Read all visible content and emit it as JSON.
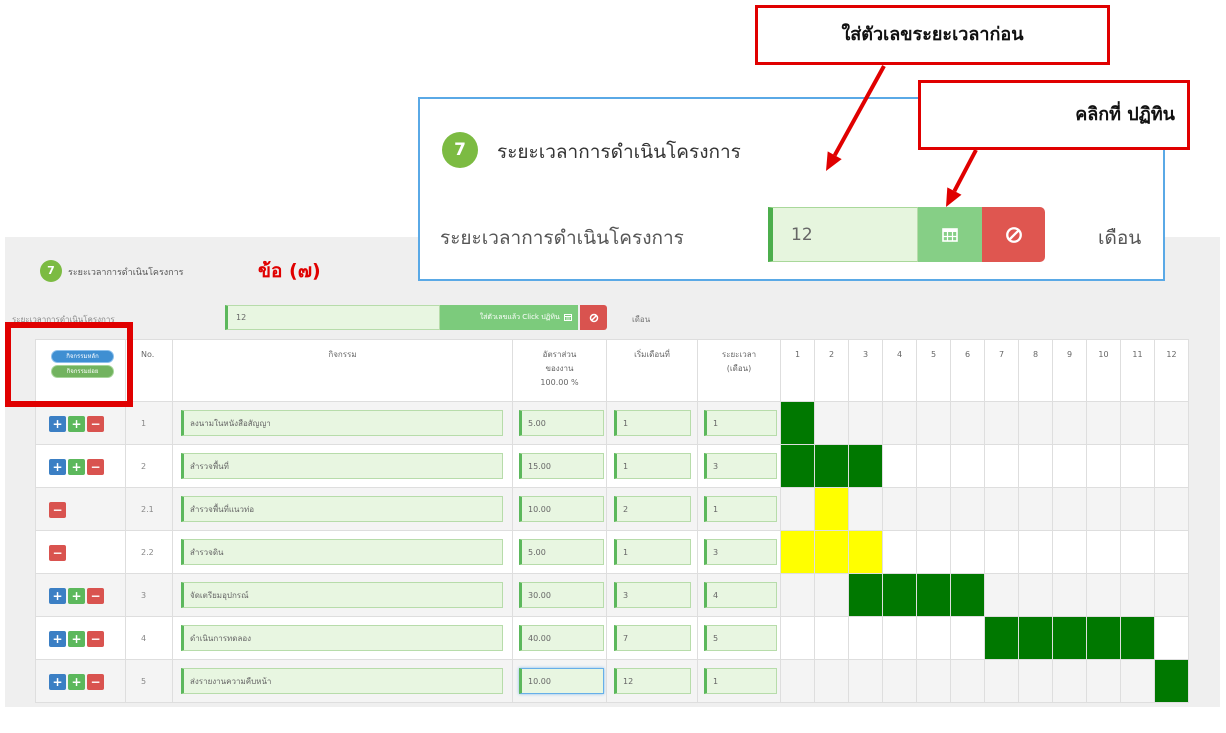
{
  "callouts": {
    "enter_number": "ใส่ตัวเลขระยะเวลาก่อน",
    "click_calendar": "คลิกที่ ปฏิทิน"
  },
  "zoom_panel": {
    "step_number": "7",
    "title": "ระยะเวลาการดำเนินโครงการ",
    "field_label": "ระยะเวลาการดำเนินโครงการ",
    "duration_value": "12",
    "unit": "เดือน",
    "calendar_icon": "calendar-icon",
    "cancel_icon": "ban-icon"
  },
  "section": {
    "step_number": "7",
    "title": "ระยะเวลาการดำเนินโครงการ",
    "annotation": "ข้อ (๗)",
    "field_label": "ระยะเวลาการดำเนินโครงการ",
    "duration_value": "12",
    "calendar_button_label": "ใส่ตัวเลขแล้ว Click ปฏิทิน",
    "unit": "เดือน"
  },
  "table": {
    "toggle_buttons": {
      "main": "กิจกรรมหลัก",
      "sub": "กิจกรรมย่อย"
    },
    "headers": {
      "no": "No.",
      "activity": "กิจกรรม",
      "weight": [
        "อัตราส่วน",
        "ของงาน",
        "100.00 %"
      ],
      "start": "เริ่มเดือนที่",
      "duration": [
        "ระยะเวลา",
        "(เดือน)"
      ]
    },
    "row_actions": {
      "add_main": "+",
      "add_sub": "+",
      "delete": "−"
    },
    "months": [
      "1",
      "2",
      "3",
      "4",
      "5",
      "6",
      "7",
      "8",
      "9",
      "10",
      "11",
      "12"
    ],
    "rows": [
      {
        "no": "1",
        "type": "main",
        "activity": "ลงนามในหนังสือสัญญา",
        "weight": "5.00",
        "start": "1",
        "duration": "1"
      },
      {
        "no": "2",
        "type": "main",
        "activity": "สำรวจพื้นที่",
        "weight": "15.00",
        "start": "1",
        "duration": "3"
      },
      {
        "no": "2.1",
        "type": "sub",
        "activity": "สำรวจพื้นที่แนวท่อ",
        "weight": "10.00",
        "start": "2",
        "duration": "1"
      },
      {
        "no": "2.2",
        "type": "sub",
        "activity": "สำรวจดิน",
        "weight": "5.00",
        "start": "1",
        "duration": "3"
      },
      {
        "no": "3",
        "type": "main",
        "activity": "จัดเตรียมอุปกรณ์",
        "weight": "30.00",
        "start": "3",
        "duration": "4"
      },
      {
        "no": "4",
        "type": "main",
        "activity": "ดำเนินการทดลอง",
        "weight": "40.00",
        "start": "7",
        "duration": "5"
      },
      {
        "no": "5",
        "type": "main",
        "activity": "ส่งรายงานความคืบหน้า",
        "weight": "10.00",
        "start": "12",
        "duration": "1",
        "focused": "weight"
      }
    ]
  },
  "colors": {
    "main_bar": "#007800",
    "sub_bar": "#ffff00",
    "annotation": "#e00000",
    "step_badge": "#7cbb42",
    "highlight": "#e00000",
    "panel_border": "#5aa9e6"
  }
}
